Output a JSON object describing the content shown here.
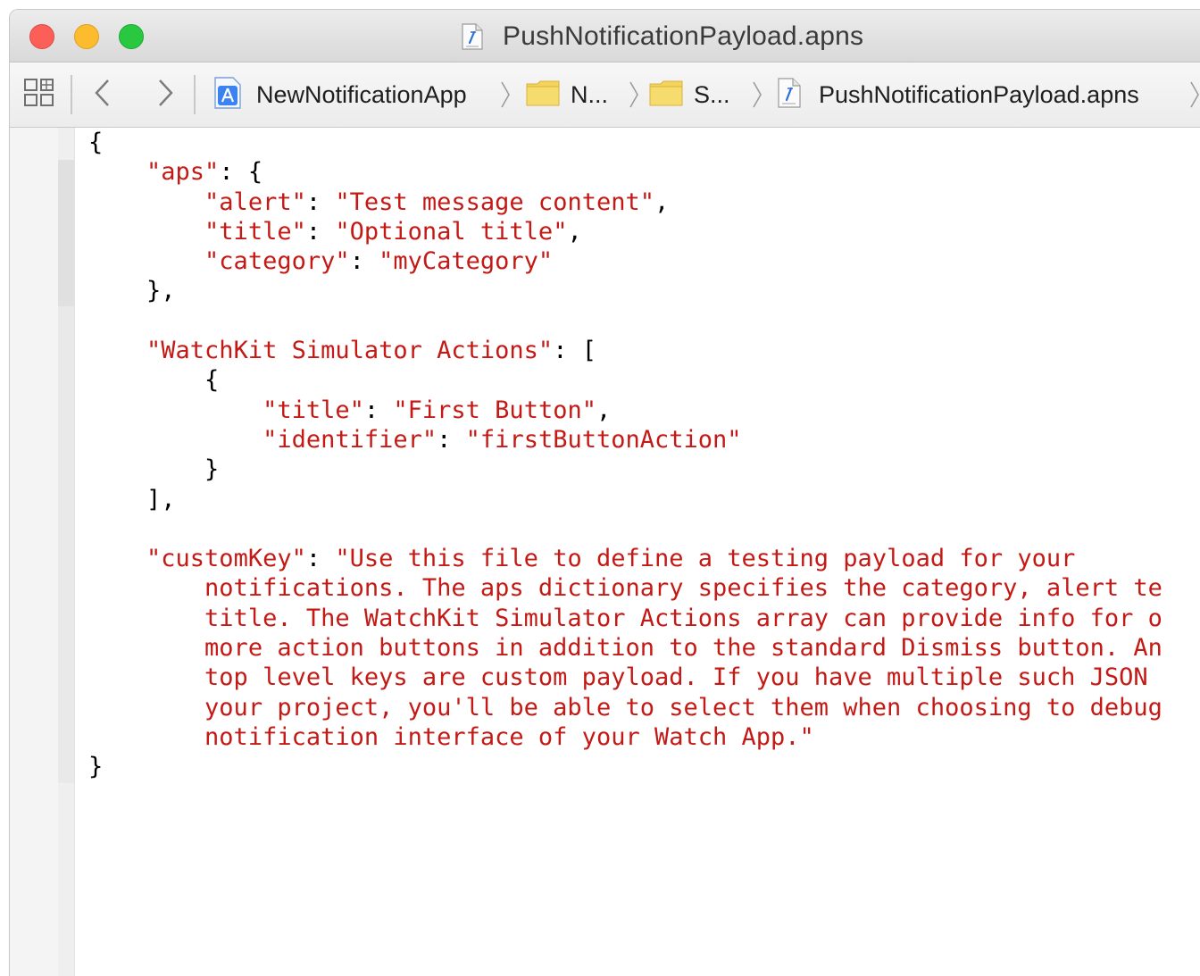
{
  "window": {
    "title": "PushNotificationPayload.apns"
  },
  "jumpbar": {
    "crumbs": [
      {
        "label": "NewNotificationApp",
        "icon": "xcode-project-icon"
      },
      {
        "label": "N...",
        "icon": "folder-icon"
      },
      {
        "label": "S...",
        "icon": "folder-icon"
      },
      {
        "label": "PushNotificationPayload.apns",
        "icon": "apns-file-icon"
      }
    ]
  },
  "code": {
    "lines": [
      [
        {
          "t": "{",
          "s": false
        }
      ],
      [
        {
          "t": "    ",
          "s": false
        },
        {
          "t": "\"aps\"",
          "s": true
        },
        {
          "t": ": {",
          "s": false
        }
      ],
      [
        {
          "t": "        ",
          "s": false
        },
        {
          "t": "\"alert\"",
          "s": true
        },
        {
          "t": ": ",
          "s": false
        },
        {
          "t": "\"Test message content\"",
          "s": true
        },
        {
          "t": ",",
          "s": false
        }
      ],
      [
        {
          "t": "        ",
          "s": false
        },
        {
          "t": "\"title\"",
          "s": true
        },
        {
          "t": ": ",
          "s": false
        },
        {
          "t": "\"Optional title\"",
          "s": true
        },
        {
          "t": ",",
          "s": false
        }
      ],
      [
        {
          "t": "        ",
          "s": false
        },
        {
          "t": "\"category\"",
          "s": true
        },
        {
          "t": ": ",
          "s": false
        },
        {
          "t": "\"myCategory\"",
          "s": true
        }
      ],
      [
        {
          "t": "    },",
          "s": false
        }
      ],
      [
        {
          "t": "",
          "s": false
        }
      ],
      [
        {
          "t": "    ",
          "s": false
        },
        {
          "t": "\"WatchKit Simulator Actions\"",
          "s": true
        },
        {
          "t": ": [",
          "s": false
        }
      ],
      [
        {
          "t": "        {",
          "s": false
        }
      ],
      [
        {
          "t": "            ",
          "s": false
        },
        {
          "t": "\"title\"",
          "s": true
        },
        {
          "t": ": ",
          "s": false
        },
        {
          "t": "\"First Button\"",
          "s": true
        },
        {
          "t": ",",
          "s": false
        }
      ],
      [
        {
          "t": "            ",
          "s": false
        },
        {
          "t": "\"identifier\"",
          "s": true
        },
        {
          "t": ": ",
          "s": false
        },
        {
          "t": "\"firstButtonAction\"",
          "s": true
        }
      ],
      [
        {
          "t": "        }",
          "s": false
        }
      ],
      [
        {
          "t": "    ],",
          "s": false
        }
      ],
      [
        {
          "t": "",
          "s": false
        }
      ],
      [
        {
          "t": "    ",
          "s": false
        },
        {
          "t": "\"customKey\"",
          "s": true
        },
        {
          "t": ": ",
          "s": false
        },
        {
          "t": "\"Use this file to define a testing payload for your",
          "s": true
        }
      ],
      [
        {
          "t": "        ",
          "s": false
        },
        {
          "t": "notifications. The aps dictionary specifies the category, alert te",
          "s": true
        }
      ],
      [
        {
          "t": "        ",
          "s": false
        },
        {
          "t": "title. The WatchKit Simulator Actions array can provide info for o",
          "s": true
        }
      ],
      [
        {
          "t": "        ",
          "s": false
        },
        {
          "t": "more action buttons in addition to the standard Dismiss button. An",
          "s": true
        }
      ],
      [
        {
          "t": "        ",
          "s": false
        },
        {
          "t": "top level keys are custom payload. If you have multiple such JSON ",
          "s": true
        }
      ],
      [
        {
          "t": "        ",
          "s": false
        },
        {
          "t": "your project, you'll be able to select them when choosing to debug",
          "s": true
        }
      ],
      [
        {
          "t": "        ",
          "s": false
        },
        {
          "t": "notification interface of your Watch App.\"",
          "s": true
        }
      ],
      [
        {
          "t": "}",
          "s": false
        }
      ]
    ]
  }
}
